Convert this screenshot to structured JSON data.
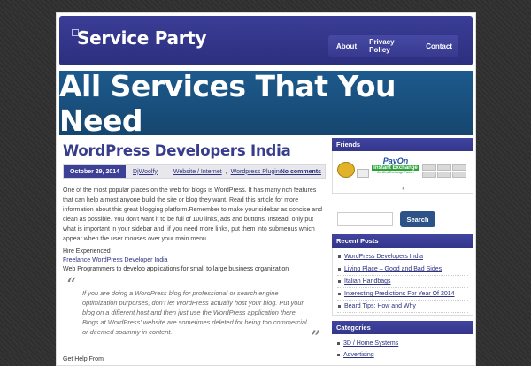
{
  "site": {
    "title": "Service Party"
  },
  "nav": {
    "items": [
      "About",
      "Privacy Policy",
      "Contact"
    ]
  },
  "banner": {
    "text": "All Services That You Need"
  },
  "post": {
    "title": "WordPress Developers India",
    "date": "October 29, 2014",
    "author": "DjWoolfy",
    "category1": "Website / Internet",
    "category2": "Wordpress Plugins",
    "comments": "No comments",
    "body": "One of the most popular places on the web for blogs is WordPress. It has many rich features that can help almost anyone build the site or blog they want. Read this article for more information about this great blogging platform.Remember to make your sidebar as concise and clean as possible. You don't want it to be full of 100 links, ads and buttons. Instead, only put what is important in your sidebar and, if you need more links, put them into submenus which appear when the user mouses over your main menu.",
    "hire_label": "Hire Experienced",
    "hire_link": "Freelance WordPress Developer India",
    "hire_desc": "Web Programmers to develop applications for small to large business organization",
    "quote": "If you are doing a WordPress blog for professional or search engine optimization purporses, don't let WordPress actually host your blog. Put your blog on a different host and then just use the WordPress application there. Blogs at WordPress' website are sometimes deleted for being too commercial or deemed spammy in content.",
    "next": "Get Help From"
  },
  "sidebar": {
    "friends_heading": "Friends",
    "friends_banner": {
      "top": "PayOn",
      "mid": "Instant Exchange",
      "low": "Certified Exchange Partner"
    },
    "search_button": "Search",
    "recent_heading": "Recent Posts",
    "recent": [
      "WordPress Developers India",
      "Living Place – Good and Bad Sides",
      "Italian Handbags",
      "Interesting Predictions For Year Of 2014",
      "Beard Tips: How and Why"
    ],
    "categories_heading": "Categories",
    "categories": [
      "3D / Home Systems",
      "Advertising"
    ]
  },
  "colors": {
    "header": "#33368a",
    "banner": "#18507f",
    "link": "#2d3180",
    "button": "#2d5288"
  }
}
